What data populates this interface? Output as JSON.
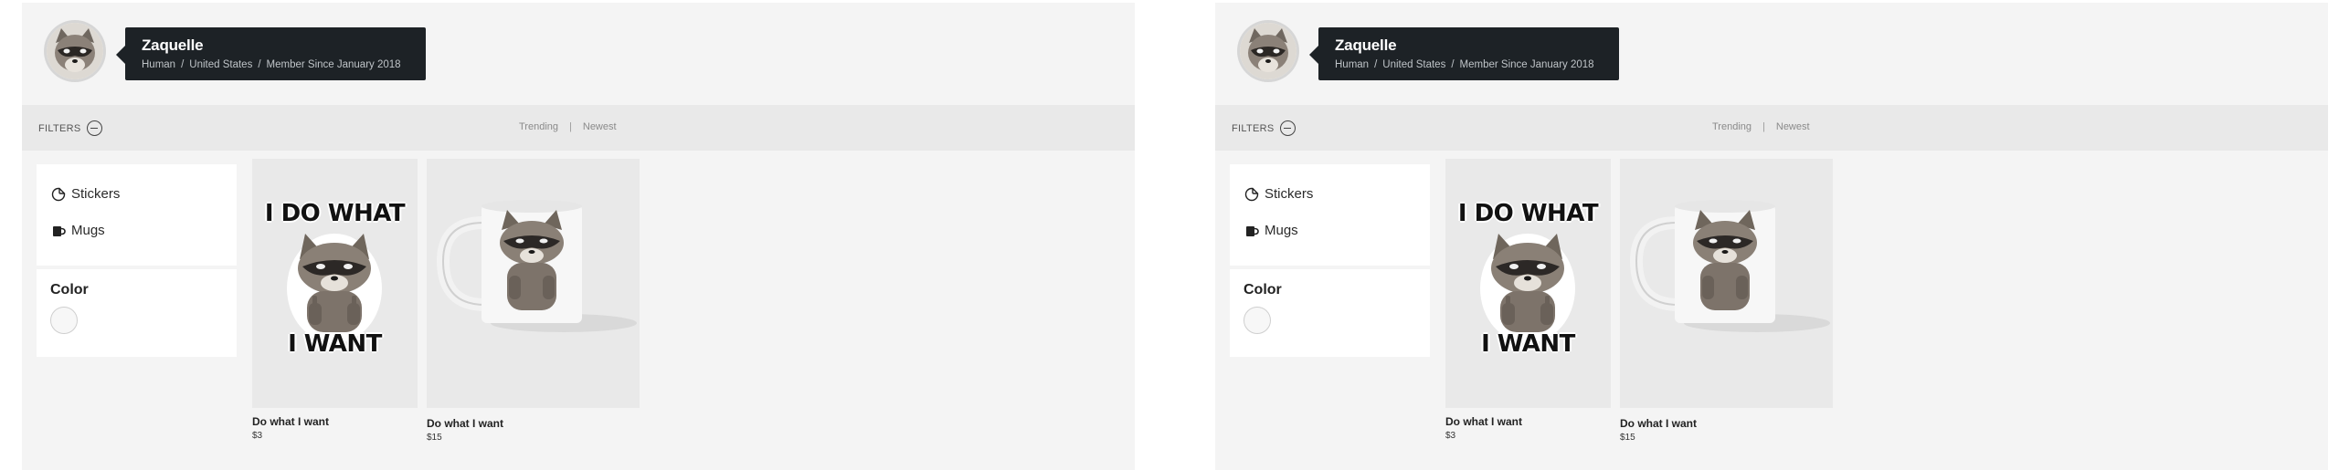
{
  "profile": {
    "name": "Zaquelle",
    "type": "Human",
    "location": "United States",
    "member_since": "Member Since January 2018"
  },
  "filters": {
    "label": "FILTERS",
    "sort_options": [
      "Trending",
      "Newest"
    ]
  },
  "sidebar": {
    "categories": [
      {
        "label": "Stickers",
        "icon": "sticker-icon"
      },
      {
        "label": "Mugs",
        "icon": "mug-icon"
      }
    ],
    "color_label": "Color"
  },
  "products": [
    {
      "title": "Do what I want",
      "price": "$3",
      "art_top": "I DO WHAT",
      "art_bottom": "I WANT"
    },
    {
      "title": "Do what I want",
      "price": "$15"
    }
  ]
}
